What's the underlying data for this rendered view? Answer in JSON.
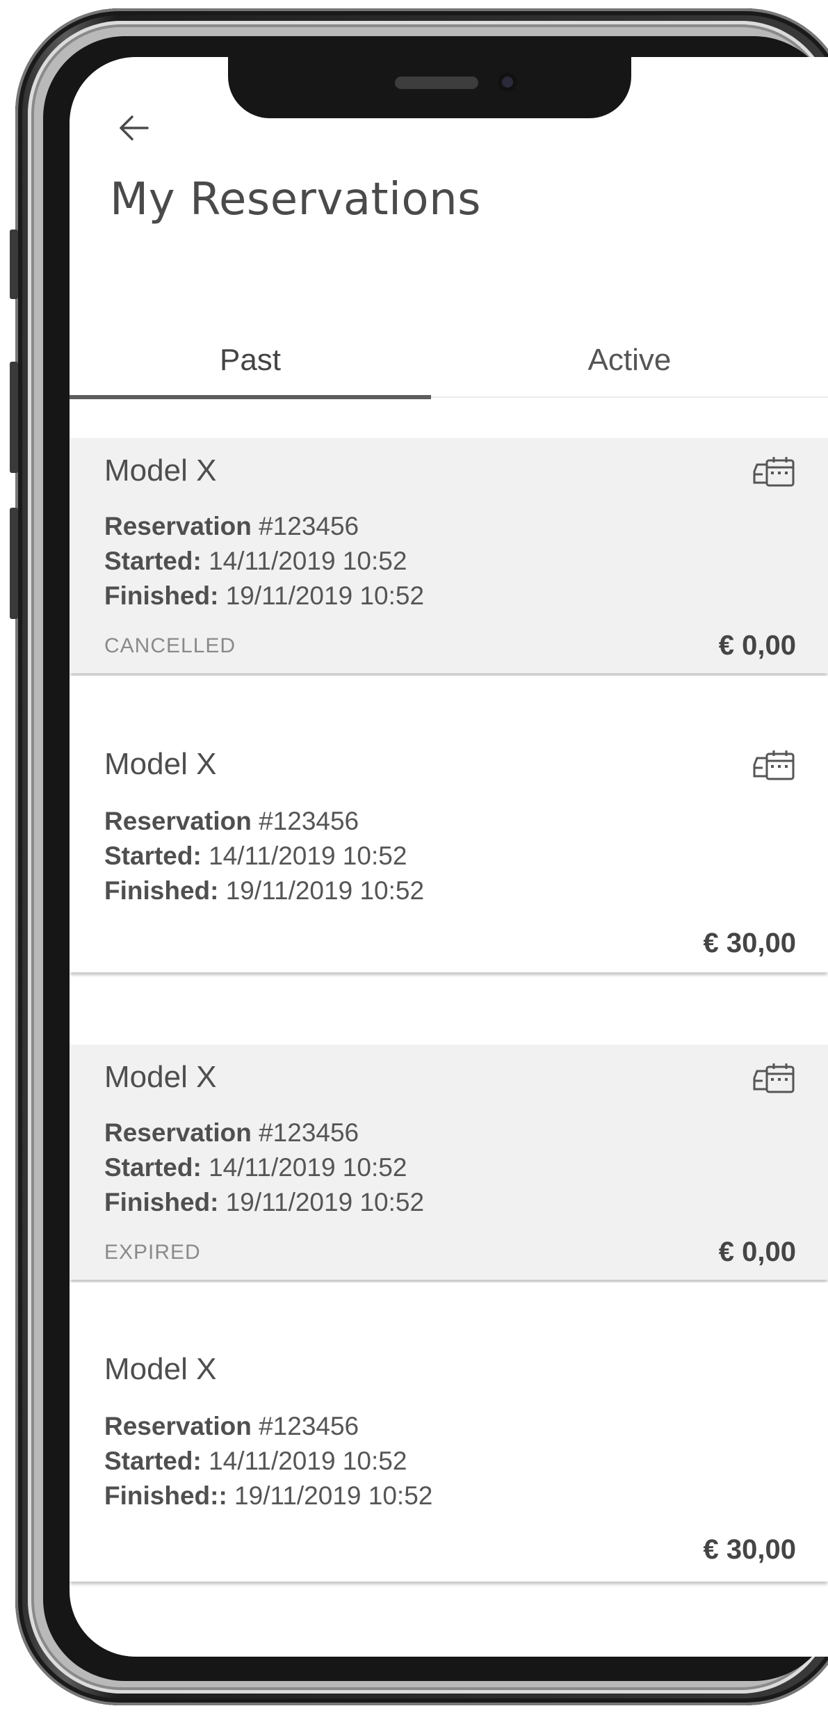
{
  "header": {
    "title": "My Reservations"
  },
  "tabs": [
    {
      "label": "Past",
      "selected": true
    },
    {
      "label": "Active",
      "selected": false
    }
  ],
  "icons": {
    "back": "arrow-left-icon",
    "card": "calendar-ticket-icon"
  },
  "reservations": [
    {
      "model": "Model X",
      "reservation_label": "Reservation",
      "reservation_number": "#123456",
      "started_label": "Started:",
      "started": "14/11/2019 10:52",
      "finished_label": "Finished:",
      "finished": "19/11/2019 10:52",
      "status": "CANCELLED",
      "price": "€ 0,00",
      "shaded": true,
      "has_icon": true
    },
    {
      "model": "Model X",
      "reservation_label": "Reservation",
      "reservation_number": "#123456",
      "started_label": "Started:",
      "started": "14/11/2019 10:52",
      "finished_label": "Finished:",
      "finished": "19/11/2019 10:52",
      "status": "",
      "price": "€ 30,00",
      "shaded": false,
      "has_icon": true
    },
    {
      "model": "Model X",
      "reservation_label": "Reservation",
      "reservation_number": "#123456",
      "started_label": "Started:",
      "started": "14/11/2019 10:52",
      "finished_label": "Finished:",
      "finished": "19/11/2019 10:52",
      "status": "EXPIRED",
      "price": "€ 0,00",
      "shaded": true,
      "has_icon": true
    },
    {
      "model": "Model X",
      "reservation_label": "Reservation",
      "reservation_number": "#123456",
      "started_label": "Started:",
      "started": "14/11/2019 10:52",
      "finished_label": "Finished::",
      "finished": "19/11/2019 10:52",
      "status": "",
      "price": "€ 30,00",
      "shaded": false,
      "has_icon": false
    }
  ],
  "colors": {
    "card_shaded": "#f1f1f1",
    "card_plain": "#ffffff",
    "tab_indicator": "#5d5d5d",
    "text_primary": "#4a4a4a"
  }
}
